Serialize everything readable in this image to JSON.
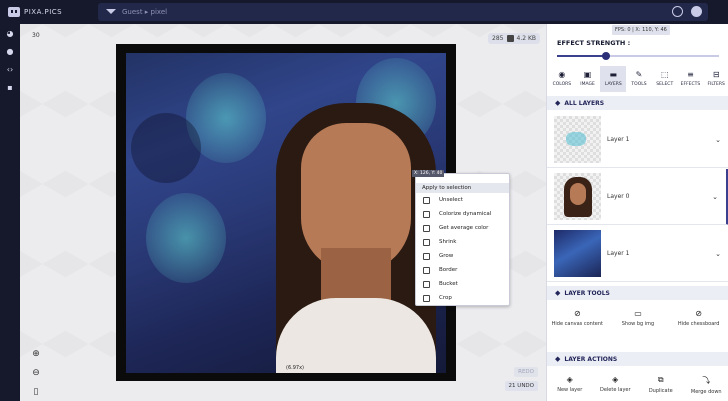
{
  "app": {
    "name": "PIXA.PICS",
    "breadcrumb": "Guest ▸ pixel"
  },
  "leftbar": {
    "icons": [
      "palette-icon",
      "user-icon",
      "code-icon",
      "chat-icon"
    ]
  },
  "canvas": {
    "brush_size": "30",
    "size_info": "285",
    "file_size": "4.2 KB",
    "zoom_label": "(6.97x)",
    "redo_label": "REDO",
    "undo_label": "21 UNDO"
  },
  "context_menu": {
    "coords": "X: 126, Y: 40",
    "title": "Apply to selection",
    "items": [
      {
        "label": "Unselect",
        "icon": "unselect-icon"
      },
      {
        "label": "Colorize dynamical",
        "icon": "colorize-icon"
      },
      {
        "label": "Get average color",
        "icon": "average-color-icon"
      },
      {
        "label": "Shrink",
        "icon": "shrink-icon"
      },
      {
        "label": "Grow",
        "icon": "grow-icon"
      },
      {
        "label": "Border",
        "icon": "border-icon"
      },
      {
        "label": "Bucket",
        "icon": "bucket-icon"
      },
      {
        "label": "Crop",
        "icon": "crop-icon"
      }
    ]
  },
  "panel": {
    "fps": "FPS: 0 | X: 110, Y: 46",
    "effect_strength_label": "EFFECT STRENGTH :",
    "effect_strength_value": 0.3,
    "tabs": [
      {
        "label": "COLORS",
        "glyph": "◉"
      },
      {
        "label": "IMAGE",
        "glyph": "▣"
      },
      {
        "label": "LAYERS",
        "glyph": "▬"
      },
      {
        "label": "TOOLS",
        "glyph": "✎"
      },
      {
        "label": "SELECT",
        "glyph": "⬚"
      },
      {
        "label": "EFFECTS",
        "glyph": "≡"
      },
      {
        "label": "FILTERS",
        "glyph": "⊟"
      }
    ],
    "active_tab": "LAYERS",
    "all_layers_title": "ALL LAYERS",
    "layers": [
      {
        "name": "Layer 1"
      },
      {
        "name": "Layer 0"
      },
      {
        "name": "Layer 1"
      }
    ],
    "layer_tools_title": "LAYER TOOLS",
    "layer_tools": [
      {
        "label": "Hide canvas content",
        "icon": "hide-canvas-icon",
        "glyph": "⊘"
      },
      {
        "label": "Show bg img",
        "icon": "show-bg-icon",
        "glyph": "▭"
      },
      {
        "label": "Hide chessboard",
        "icon": "hide-chessboard-icon",
        "glyph": "⊘"
      }
    ],
    "layer_actions_title": "LAYER ACTIONS",
    "layer_actions": [
      {
        "label": "New layer",
        "icon": "new-layer-icon",
        "glyph": "◈"
      },
      {
        "label": "Delete layer",
        "icon": "delete-layer-icon",
        "glyph": "◈"
      },
      {
        "label": "Duplicate",
        "icon": "duplicate-icon",
        "glyph": "⧉"
      },
      {
        "label": "Merge down",
        "icon": "merge-down-icon",
        "glyph": "⤵"
      }
    ]
  }
}
